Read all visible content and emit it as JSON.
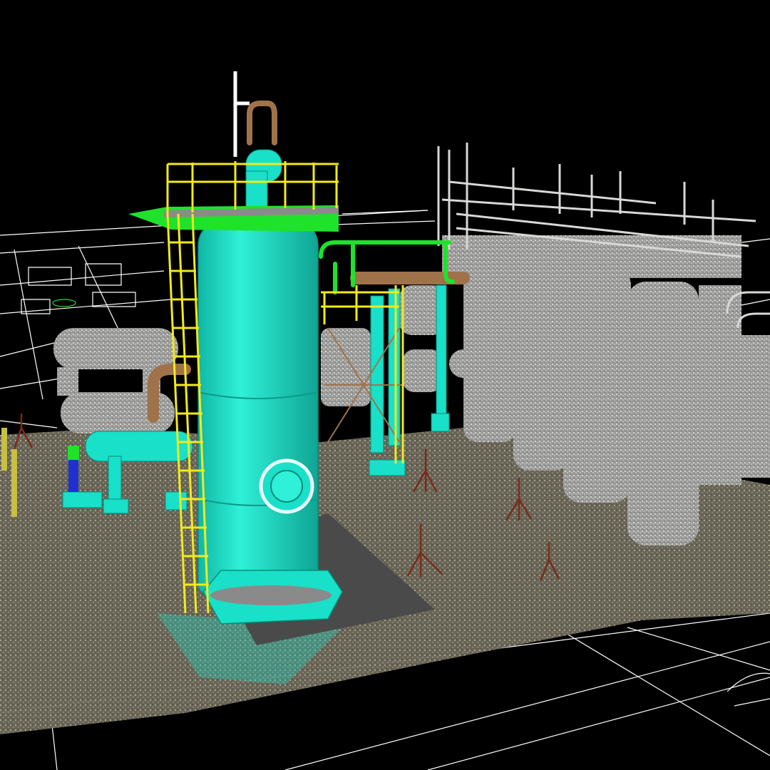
{
  "viewport": {
    "background": "#000000",
    "wireframe_color": "#ffffff",
    "vessel_color": "#19e0c8",
    "railing_color": "#f2ea1c",
    "pipe_green": "#1ee32a",
    "pipe_copper": "#a0724a",
    "pointcloud_gray": "#bfbfbf",
    "ground_tone": "#8a8270",
    "pad_color": "#4a4a4a",
    "tripod_color": "#7a2a1a"
  },
  "objects": {
    "main_vessel": "vertical-pressure-vessel",
    "platform": "top-platform-with-railing",
    "ladder": "caged-access-ladder",
    "manway": "vessel-manway",
    "scanned_tanks": "scanned-tank-bank",
    "scanned_exchangers": "scanned-heat-exchangers",
    "cad_floorplan": "cad-floorplan-overlay",
    "survey_tripods": "laser-scanner-tripods",
    "worker": "scanned-worker-figure"
  }
}
